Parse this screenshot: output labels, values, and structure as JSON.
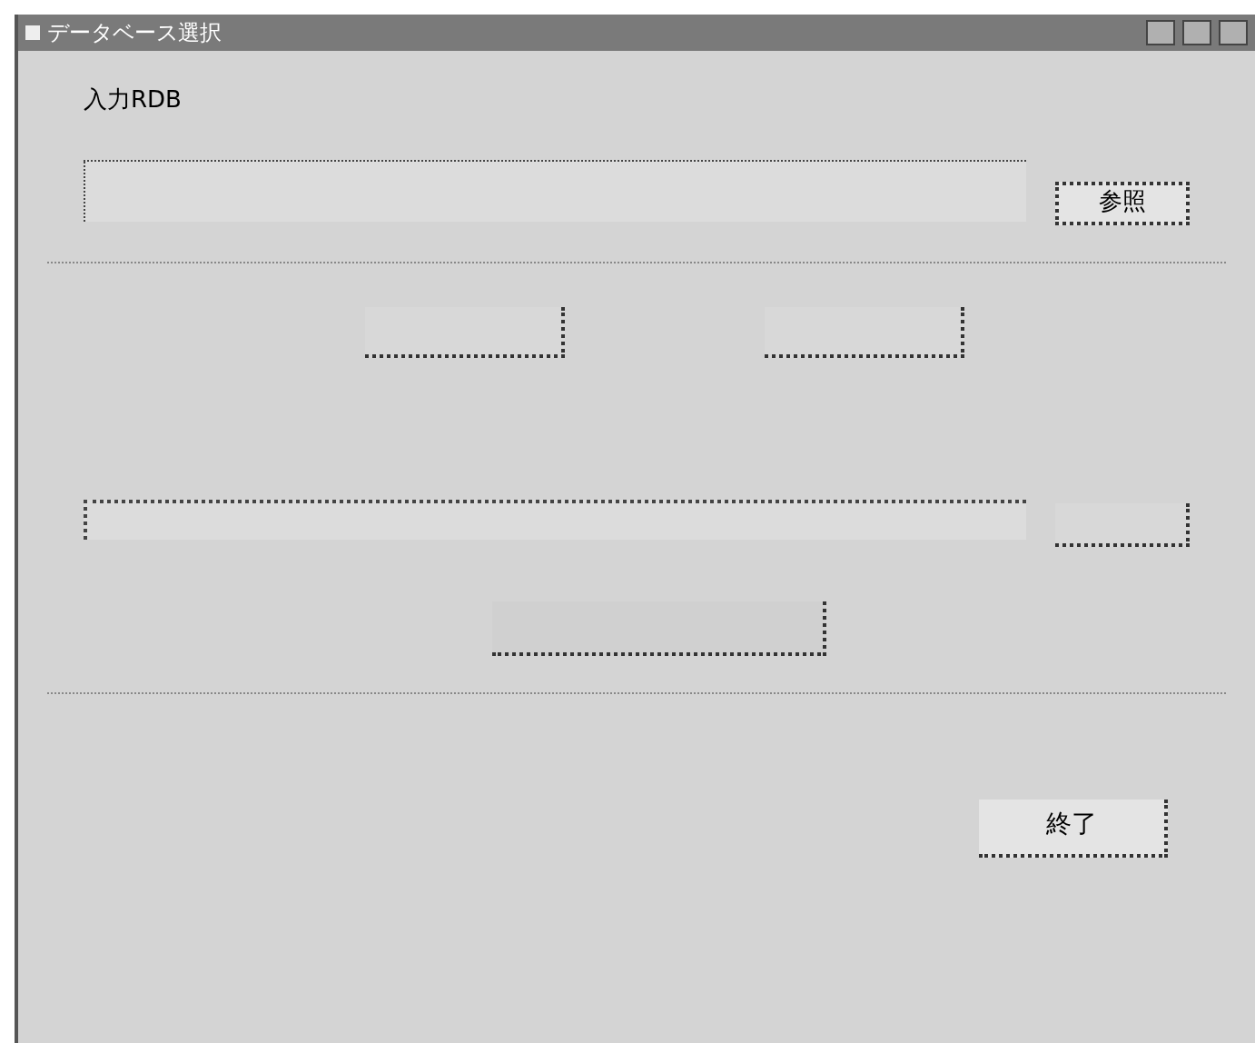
{
  "window": {
    "title": "データベース選択"
  },
  "input_rdb": {
    "label": "入力RDB",
    "browse_button": "参照"
  },
  "exit_button": "終了"
}
